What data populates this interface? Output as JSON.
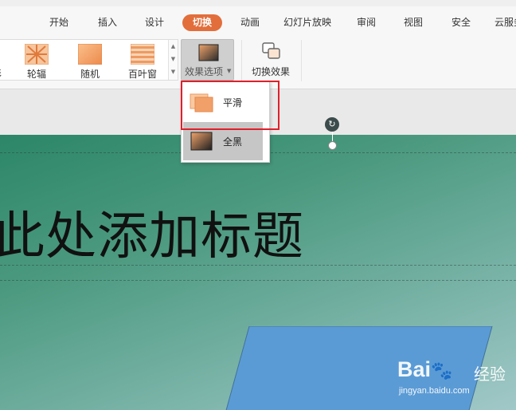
{
  "tabs": [
    {
      "label": "开始",
      "active": false
    },
    {
      "label": "插入",
      "active": false
    },
    {
      "label": "设计",
      "active": false
    },
    {
      "label": "切换",
      "active": true
    },
    {
      "label": "动画",
      "active": false
    },
    {
      "label": "幻灯片放映",
      "active": false
    },
    {
      "label": "审阅",
      "active": false
    },
    {
      "label": "视图",
      "active": false
    },
    {
      "label": "安全",
      "active": false
    },
    {
      "label": "云服务",
      "active": false
    }
  ],
  "gallery": {
    "items": [
      {
        "label": "轮辐",
        "icon": "wheel-transition-icon"
      },
      {
        "label": "随机",
        "icon": "random-transition-icon"
      },
      {
        "label": "百叶窗",
        "icon": "blinds-transition-icon"
      }
    ],
    "partial_label": "…"
  },
  "effect_options": {
    "label": "效果选项",
    "icon": "effect-options-icon"
  },
  "switch_effect": {
    "label": "切换效果",
    "icon": "switch-effect-icon"
  },
  "dropdown": {
    "items": [
      {
        "label": "平滑",
        "icon": "smooth-effect-icon",
        "highlighted_by_annotation": true
      },
      {
        "label": "全黑",
        "icon": "black-effect-icon",
        "hovered": true
      }
    ]
  },
  "slide": {
    "title": "此处添加标题",
    "title_visible": "此处添加标题"
  },
  "watermark": {
    "logo": "Bai 经验",
    "url": "jingyan.baidu.com"
  },
  "colors": {
    "accent": "#e26e3b",
    "annotation": "#e0202a",
    "shape_fill": "#5b9bd5"
  }
}
